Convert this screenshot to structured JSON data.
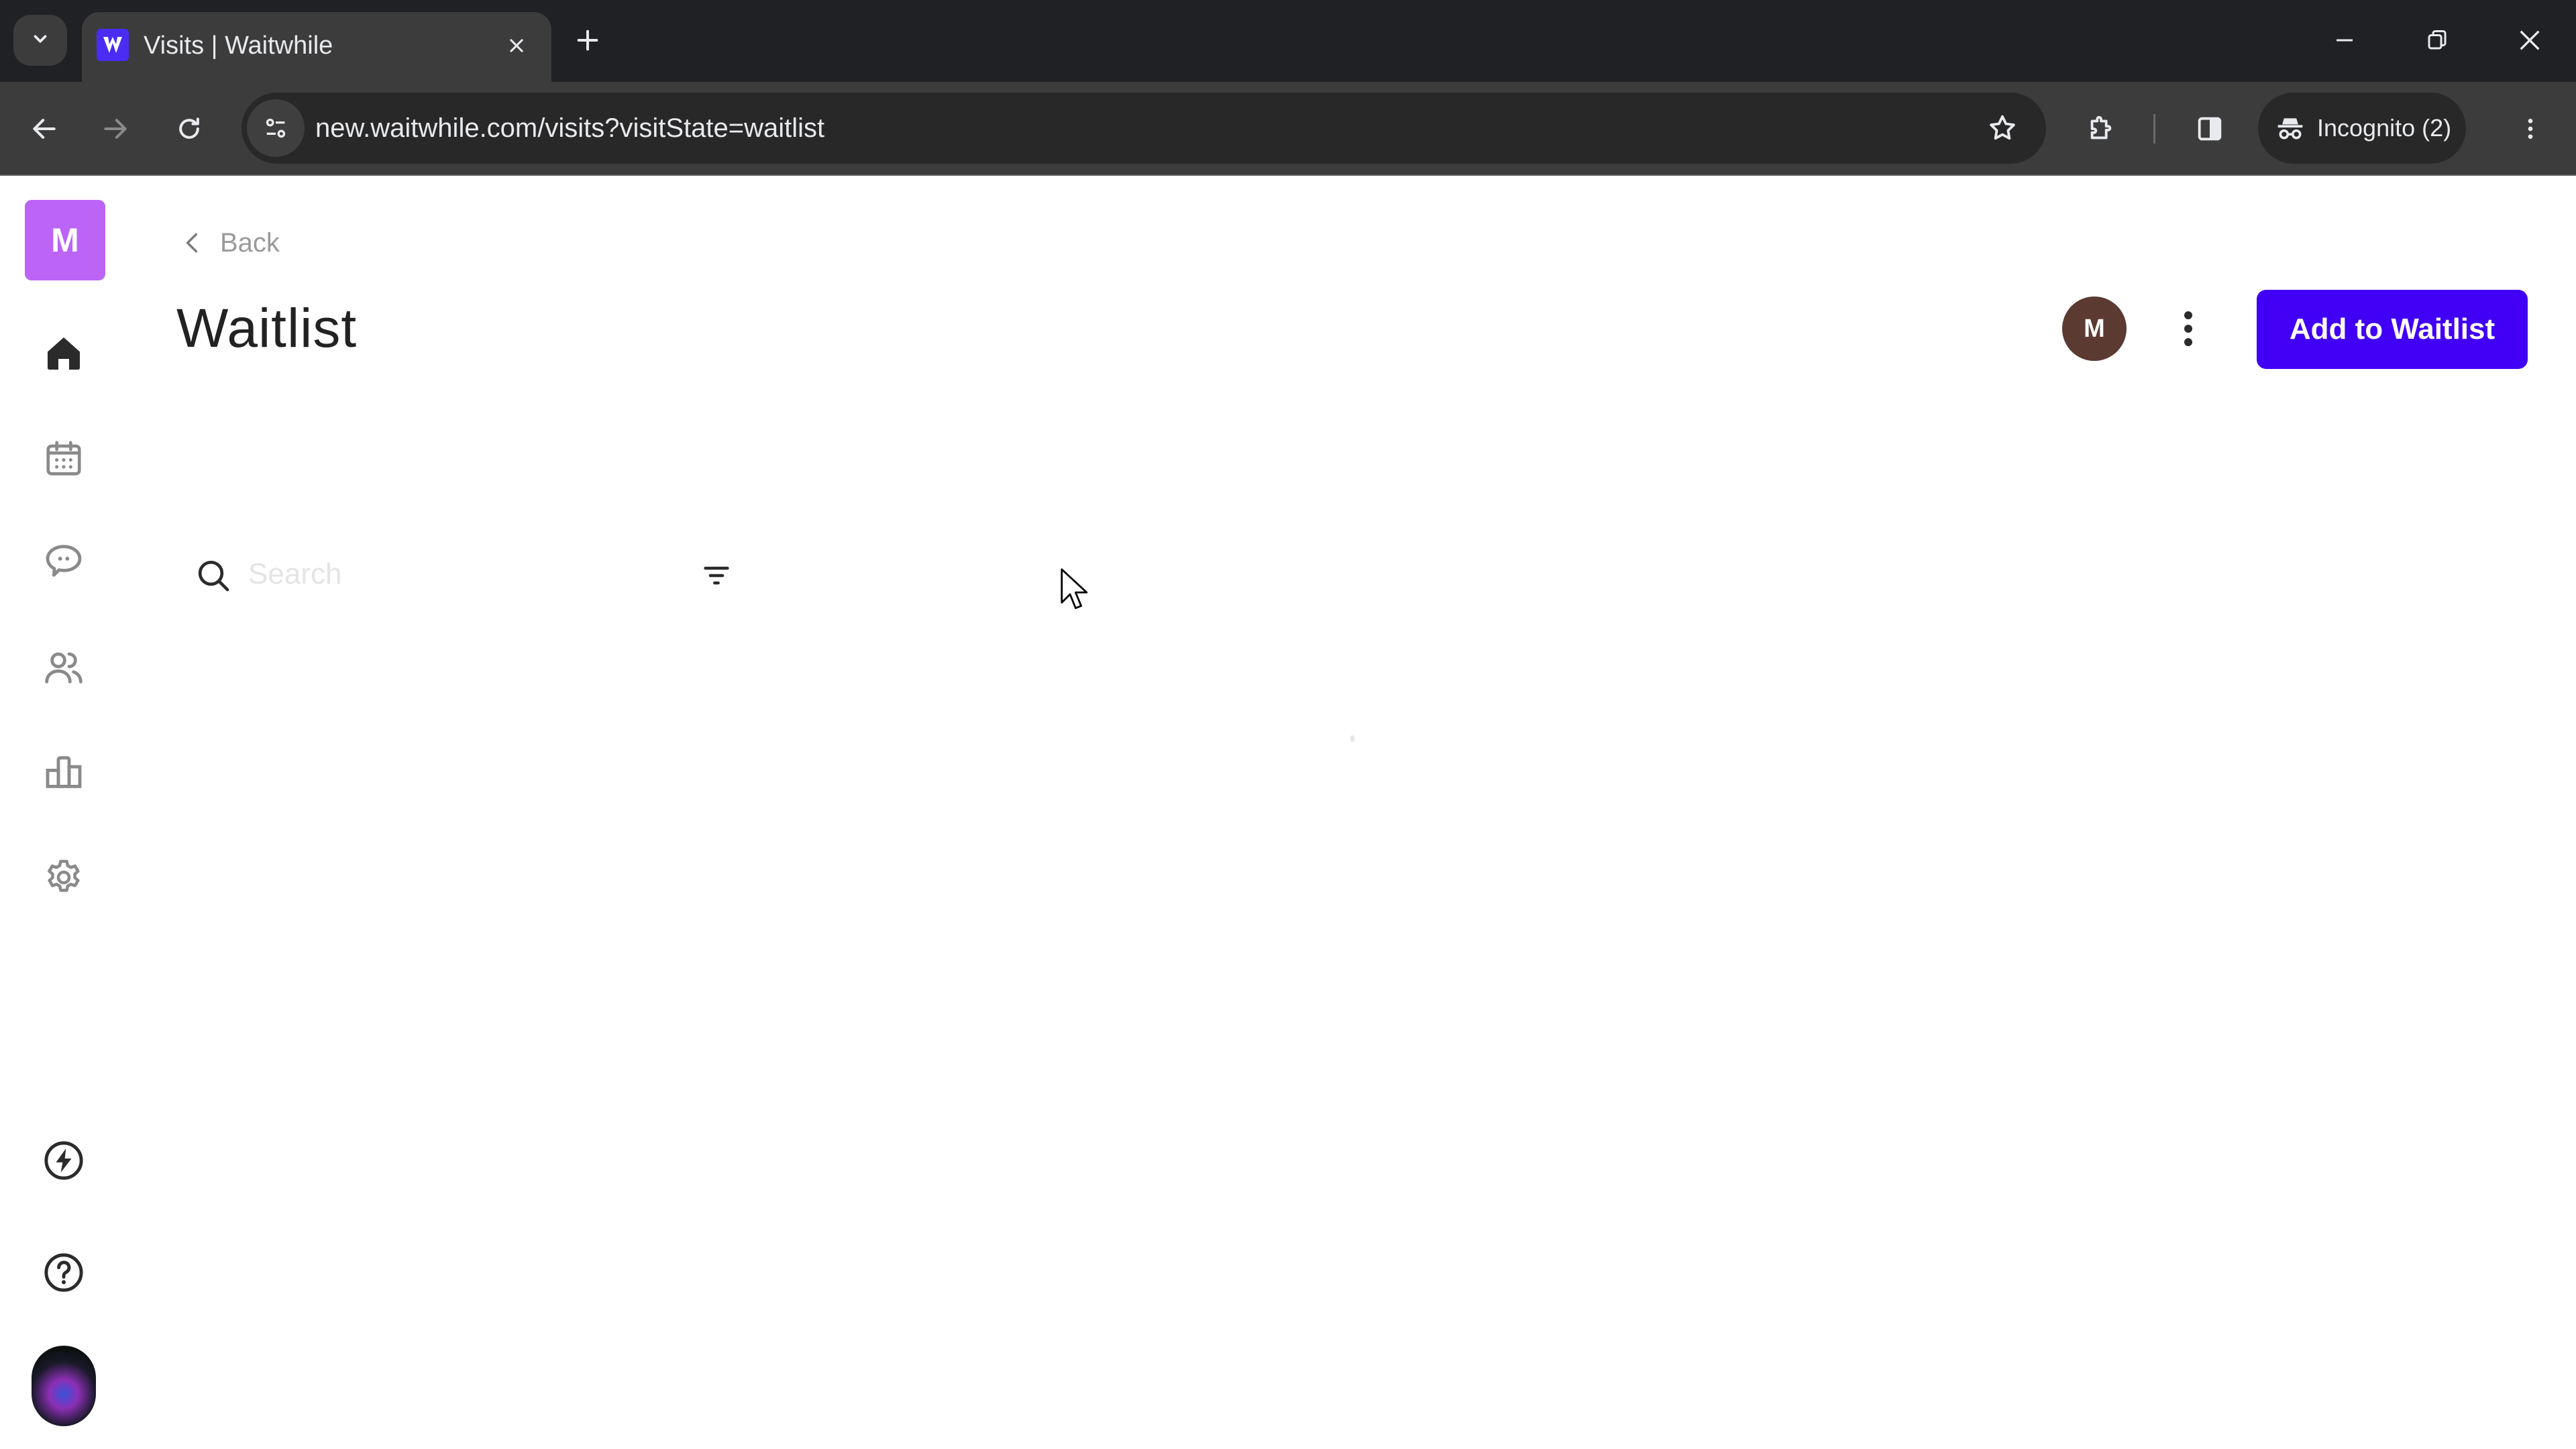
{
  "browser": {
    "tab": {
      "title": "Visits | Waitwhile",
      "favicon": "waitwhile-logo-icon"
    },
    "url": "new.waitwhile.com/visits?visitState=waitlist",
    "incognito_label": "Incognito (2)",
    "icons": {
      "tab_search": "chevron-down-icon",
      "tab_close": "close-icon",
      "new_tab": "plus-icon",
      "back": "arrow-left-icon",
      "forward": "arrow-right-icon",
      "reload": "reload-icon",
      "site_info": "tune-icon",
      "bookmark": "star-icon",
      "extensions": "puzzle-icon",
      "side_panel": "side-panel-icon",
      "incognito": "incognito-icon",
      "menu": "kebab-icon",
      "minimize": "minimize-icon",
      "restore": "restore-icon",
      "close_window": "close-icon"
    }
  },
  "sidebar": {
    "org_initial": "M",
    "items": [
      {
        "name": "home",
        "icon": "home-icon",
        "active": true
      },
      {
        "name": "calendar",
        "icon": "calendar-icon",
        "active": false
      },
      {
        "name": "messages",
        "icon": "chat-icon",
        "active": false
      },
      {
        "name": "customers",
        "icon": "users-icon",
        "active": false
      },
      {
        "name": "analytics",
        "icon": "bar-chart-icon",
        "active": false
      },
      {
        "name": "settings",
        "icon": "gear-icon",
        "active": false
      }
    ],
    "bottom": [
      {
        "name": "whats-new",
        "icon": "bolt-icon"
      },
      {
        "name": "help",
        "icon": "help-icon"
      },
      {
        "name": "profile",
        "icon": "profile-photo"
      }
    ]
  },
  "header": {
    "back_label": "Back",
    "title": "Waitlist",
    "user_initial": "M",
    "primary_action": "Add to Waitlist"
  },
  "search": {
    "placeholder": "Search",
    "value": ""
  },
  "colors": {
    "brand": "#4100f5",
    "org_logo": "#bb64f6",
    "user_avatar": "#5b3a32",
    "favicon": "#4a2cf5"
  }
}
